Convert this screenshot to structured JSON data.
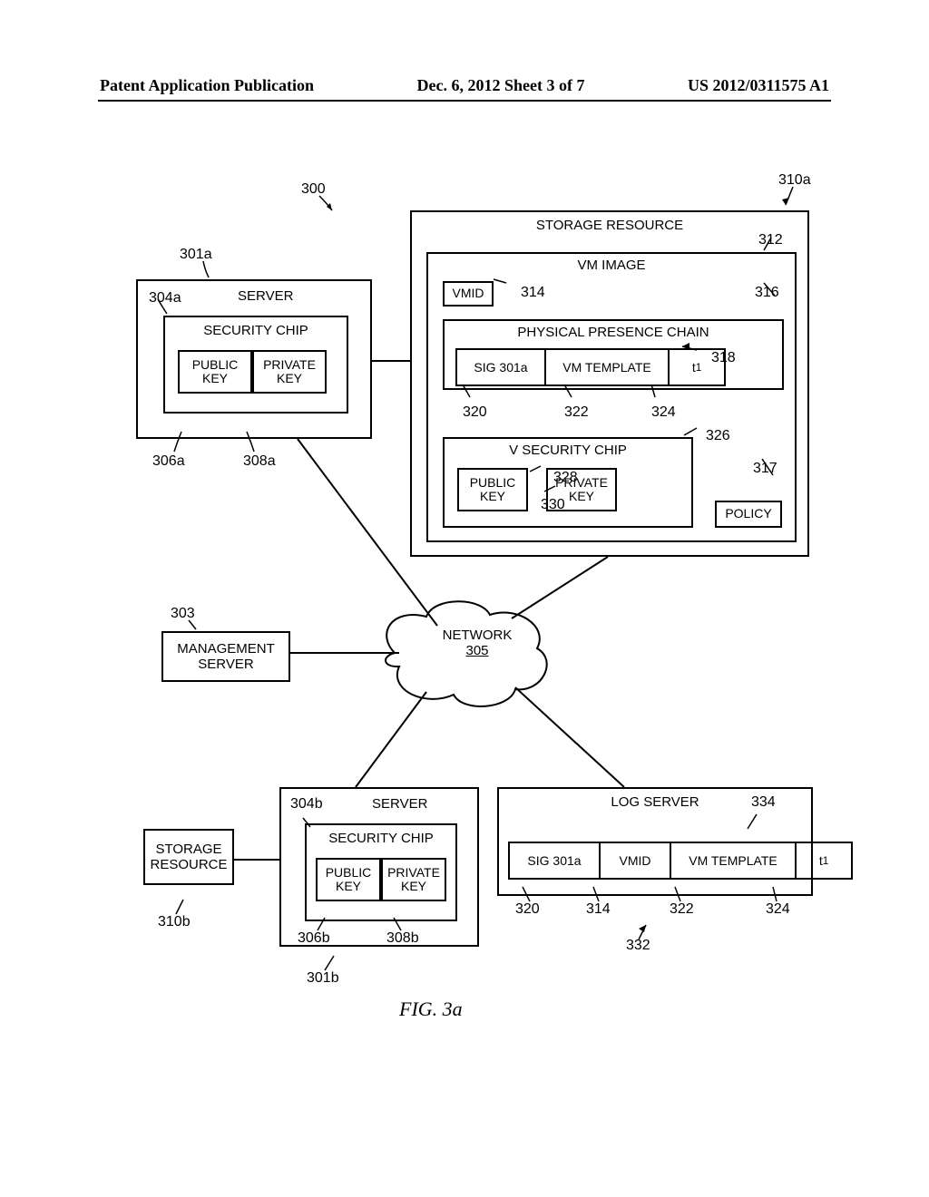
{
  "header": {
    "left": "Patent Application Publication",
    "center": "Dec. 6, 2012  Sheet 3 of 7",
    "right": "US 2012/0311575 A1"
  },
  "refs": {
    "r300": "300",
    "r301a": "301a",
    "r301b": "301b",
    "r303": "303",
    "r304a": "304a",
    "r304b": "304b",
    "r306a": "306a",
    "r306b": "306b",
    "r308a": "308a",
    "r308b": "308b",
    "r310a": "310a",
    "r310b": "310b",
    "r312": "312",
    "r314": "314",
    "r316": "316",
    "r317": "317",
    "r318": "318",
    "r320": "320",
    "r322": "322",
    "r324": "324",
    "r326": "326",
    "r328": "328",
    "r330": "330",
    "r332": "332",
    "r334": "334"
  },
  "labels": {
    "server": "SERVER",
    "security_chip": "SECURITY CHIP",
    "public_key": "PUBLIC KEY",
    "private_key": "PRIVATE KEY",
    "storage_resource": "STORAGE RESOURCE",
    "vm_image": "VM IMAGE",
    "vmid": "VMID",
    "physical_presence_chain": "PHYSICAL PRESENCE CHAIN",
    "sig_301a": "SIG 301a",
    "vm_template": "VM TEMPLATE",
    "t1": "t",
    "t1_sub": "1",
    "v_security_chip": "V SECURITY CHIP",
    "policy": "POLICY",
    "network": "NETWORK",
    "network_id": "305",
    "mgmt_server": "MANAGEMENT SERVER",
    "log_server": "LOG SERVER",
    "storage_resource_small": "STORAGE RESOURCE"
  },
  "figure_caption": "FIG.  3a"
}
